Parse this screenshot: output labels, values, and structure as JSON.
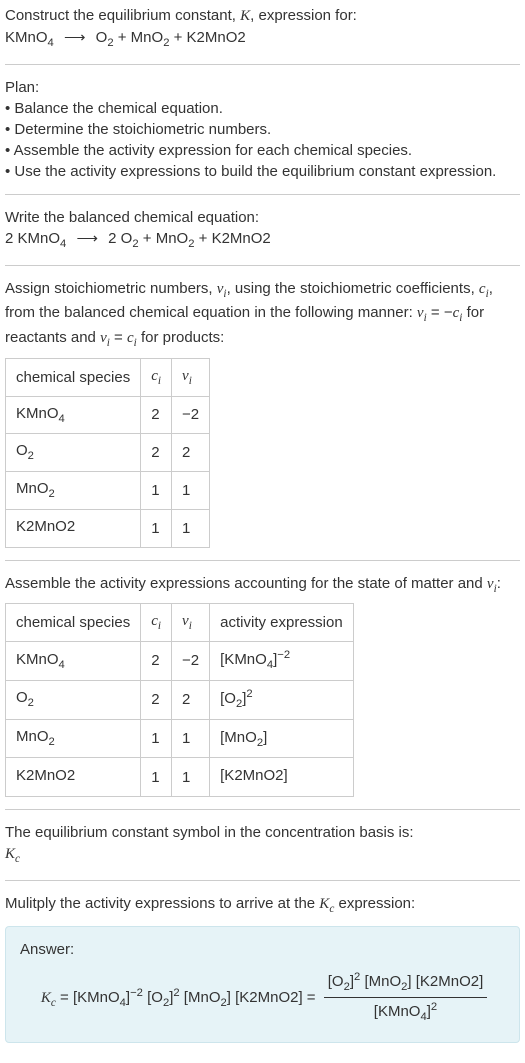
{
  "header": {
    "line1": "Construct the equilibrium constant, ",
    "K": "K",
    "line1b": ", expression for:",
    "eq_lhs": "KMnO",
    "eq_lhs_sub": "4",
    "arrow": "⟶",
    "eq_rhs1": "O",
    "eq_rhs1_sub": "2",
    "plus1": " + MnO",
    "eq_rhs2_sub": "2",
    "plus2": " + K2MnO2"
  },
  "plan": {
    "title": "Plan:",
    "b1": "• Balance the chemical equation.",
    "b2": "• Determine the stoichiometric numbers.",
    "b3": "• Assemble the activity expression for each chemical species.",
    "b4": "• Use the activity expressions to build the equilibrium constant expression."
  },
  "balanced": {
    "title": "Write the balanced chemical equation:",
    "lhs_coef": "2 KMnO",
    "lhs_sub": "4",
    "arrow": "⟶",
    "rhs1": "2 O",
    "rhs1_sub": "2",
    "rhs2": " + MnO",
    "rhs2_sub": "2",
    "rhs3": " + K2MnO2"
  },
  "stoich": {
    "intro1": "Assign stoichiometric numbers, ",
    "vi": "ν",
    "vi_sub": "i",
    "intro1b": ", using the stoichiometric coefficients, ",
    "ci": "c",
    "ci_sub": "i",
    "intro1c": ", from the balanced chemical equation in the following manner: ",
    "eq_v": "ν",
    "eq_v_sub": "i",
    "eq_eq": " = −",
    "eq_c": "c",
    "eq_c_sub": "i",
    "intro1d": " for reactants and ",
    "eq2_v": "ν",
    "eq2_vs": "i",
    "eq2_eq": " = ",
    "eq2_c": "c",
    "eq2_cs": "i",
    "intro1e": " for products:",
    "header": {
      "a": "chemical species",
      "b": "c",
      "bs": "i",
      "c": "ν",
      "cs": "i"
    },
    "rows": [
      {
        "species": "KMnO",
        "sub": "4",
        "c": "2",
        "v": "−2"
      },
      {
        "species": "O",
        "sub": "2",
        "c": "2",
        "v": "2"
      },
      {
        "species": "MnO",
        "sub": "2",
        "c": "1",
        "v": "1"
      },
      {
        "species": "K2MnO2",
        "sub": "",
        "c": "1",
        "v": "1"
      }
    ]
  },
  "activity": {
    "intro": "Assemble the activity expressions accounting for the state of matter and ",
    "vi": "ν",
    "vi_sub": "i",
    "colon": ":",
    "header": {
      "a": "chemical species",
      "b": "c",
      "bs": "i",
      "c": "ν",
      "cs": "i",
      "d": "activity expression"
    },
    "rows": [
      {
        "species": "KMnO",
        "sub": "4",
        "c": "2",
        "v": "−2",
        "act": "[KMnO",
        "act_sub": "4",
        "act_close": "]",
        "act_sup": "−2"
      },
      {
        "species": "O",
        "sub": "2",
        "c": "2",
        "v": "2",
        "act": "[O",
        "act_sub": "2",
        "act_close": "]",
        "act_sup": "2"
      },
      {
        "species": "MnO",
        "sub": "2",
        "c": "1",
        "v": "1",
        "act": "[MnO",
        "act_sub": "2",
        "act_close": "]",
        "act_sup": ""
      },
      {
        "species": "K2MnO2",
        "sub": "",
        "c": "1",
        "v": "1",
        "act": "[K2MnO2",
        "act_sub": "",
        "act_close": "]",
        "act_sup": ""
      }
    ]
  },
  "kc_symbol": {
    "line": "The equilibrium constant symbol in the concentration basis is:",
    "K": "K",
    "c": "c"
  },
  "multiply": {
    "line1": "Mulitply the activity expressions to arrive at the ",
    "K": "K",
    "c": "c",
    "line1b": " expression:"
  },
  "answer": {
    "label": "Answer:",
    "Kc_K": "K",
    "Kc_c": "c",
    "eq1": " = ",
    "t1": "[KMnO",
    "t1s": "4",
    "t1c": "]",
    "t1p": "−2",
    "t2": " [O",
    "t2s": "2",
    "t2c": "]",
    "t2p": "2",
    "t3": " [MnO",
    "t3s": "2",
    "t3c": "]",
    "t4": " [K2MnO2]",
    "eq2": " = ",
    "num1": "[O",
    "num1s": "2",
    "num1c": "]",
    "num1p": "2",
    "num2": " [MnO",
    "num2s": "2",
    "num2c": "]",
    "num3": " [K2MnO2]",
    "den1": "[KMnO",
    "den1s": "4",
    "den1c": "]",
    "den1p": "2"
  }
}
